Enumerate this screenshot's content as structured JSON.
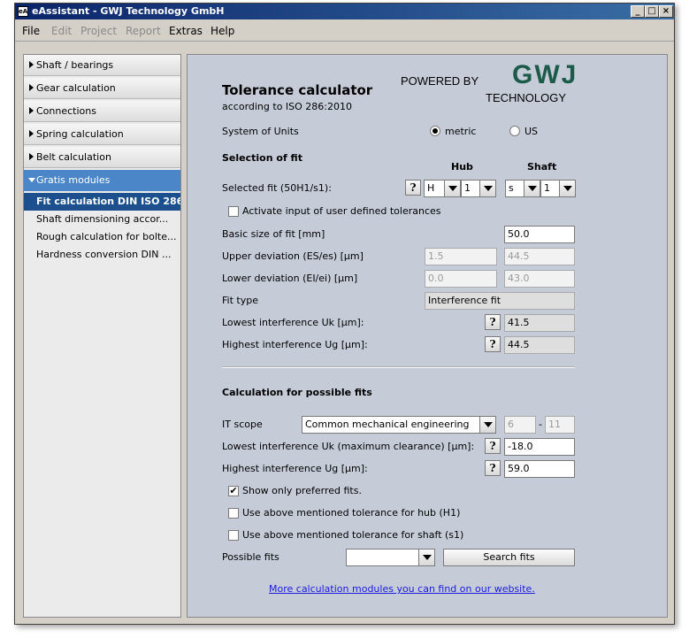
{
  "window": {
    "title": "eAssistant - GWJ Technology GmbH",
    "app_icon": "eA"
  },
  "menu": [
    "File",
    "Edit",
    "Project",
    "Report",
    "Extras",
    "Help"
  ],
  "sidebar": {
    "items": [
      "Shaft / bearings",
      "Gear calculation",
      "Connections",
      "Spring calculation",
      "Belt calculation"
    ],
    "active": "Gratis modules",
    "subitems": [
      "Fit calculation DIN ISO 286",
      "Shaft dimensioning accor...",
      "Rough calculation for bolte...",
      "Hardness conversion DIN ..."
    ]
  },
  "header": {
    "title": "Tolerance calculator",
    "subtitle": "according to ISO 286:2010",
    "powered_by": "POWERED BY",
    "logo": "GWJ",
    "logo_sub": "TECHNOLOGY"
  },
  "units": {
    "label": "System of Units",
    "metric": "metric",
    "us": "US",
    "selected": "metric"
  },
  "fit": {
    "section": "Selection of fit",
    "hub_label": "Hub",
    "shaft_label": "Shaft",
    "selected_label": "Selected fit (50H1/s1):",
    "hub_letter": "H",
    "hub_grade": "1",
    "shaft_letter": "s",
    "shaft_grade": "1",
    "user_tolerances": "Activate input of user defined tolerances",
    "basic_label": "Basic size of fit [mm]",
    "basic_value": "50.0",
    "upper_label": "Upper deviation (ES/es) [µm]",
    "upper_hub": "1.5",
    "upper_shaft": "44.5",
    "lower_label": "Lower deviation (EI/ei) [µm]",
    "lower_hub": "0.0",
    "lower_shaft": "43.0",
    "fittype_label": "Fit type",
    "fittype_value": "Interference fit",
    "uk_label": "Lowest interference Uk [µm]:",
    "uk_value": "41.5",
    "ug_label": "Highest interference Ug [µm]:",
    "ug_value": "44.5"
  },
  "possible": {
    "section": "Calculation for possible fits",
    "it_label": "IT scope",
    "it_value": "Common mechanical engineering",
    "it_from": "6",
    "it_dash": "-",
    "it_to": "11",
    "uk_label": "Lowest interference Uk (maximum clearance) [µm]:",
    "uk_value": "-18.0",
    "ug_label": "Highest interference Ug [µm]:",
    "ug_value": "59.0",
    "preferred": "Show only preferred fits.",
    "preferred_checked": true,
    "use_hub": "Use above mentioned tolerance for hub (H1)",
    "use_shaft": "Use above mentioned tolerance for shaft (s1)",
    "possible_label": "Possible fits",
    "search_button": "Search fits",
    "website_link": "More calculation modules you can find on our website."
  },
  "colors": {
    "title_start": "#0a246a",
    "title_end": "#3a6ea5",
    "sidebar_active": "#4a86c8",
    "sidebar_selected": "#1c4f8d",
    "panel": "#c5ccd8",
    "logo_green": "#1c5a4a"
  }
}
